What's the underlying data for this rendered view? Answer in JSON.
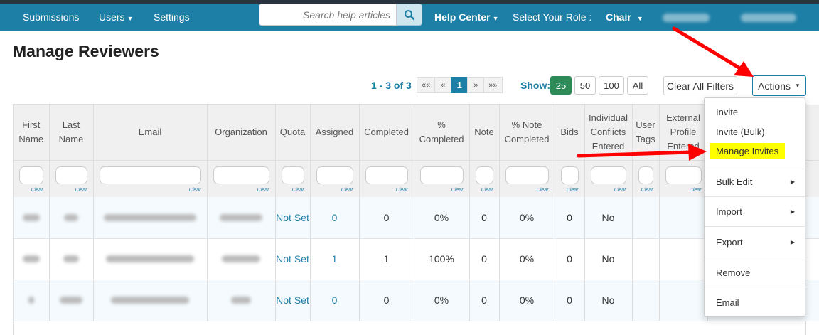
{
  "nav": {
    "submissions": "Submissions",
    "users": "Users",
    "settings": "Settings",
    "search_placeholder": "Search help articles",
    "help_center": "Help Center",
    "select_role": "Select Your Role :",
    "role": "Chair"
  },
  "page": {
    "title": "Manage Reviewers"
  },
  "pager": {
    "range": "1 - 3 of",
    "total": "3",
    "first": "««",
    "prev": "«",
    "current": "1",
    "next": "»",
    "last": "»»",
    "show_label": "Show:",
    "sizes": [
      "25",
      "50",
      "100",
      "All"
    ],
    "clear_all": "Clear All Filters",
    "actions": "Actions"
  },
  "table": {
    "headers": [
      "First Name",
      "Last Name",
      "Email",
      "Organization",
      "Quota",
      "Assigned",
      "Completed",
      "% Completed",
      "Note",
      "% Note Completed",
      "Bids",
      "Individual Conflicts Entered",
      "User Tags",
      "External Profile Entered"
    ],
    "clear_label": "Clear",
    "rows": [
      {
        "quota": "Not Set",
        "assigned": "0",
        "completed": "0",
        "pct_completed": "0%",
        "note": "0",
        "pct_note": "0%",
        "bids": "0",
        "conflicts": "No"
      },
      {
        "quota": "Not Set",
        "assigned": "1",
        "completed": "1",
        "pct_completed": "100%",
        "note": "0",
        "pct_note": "0%",
        "bids": "0",
        "conflicts": "No"
      },
      {
        "quota": "Not Set",
        "assigned": "0",
        "completed": "0",
        "pct_completed": "0%",
        "note": "0",
        "pct_note": "0%",
        "bids": "0",
        "conflicts": "No"
      }
    ]
  },
  "menu": {
    "invite": "Invite",
    "invite_bulk": "Invite (Bulk)",
    "manage_invites": "Manage Invites",
    "bulk_edit": "Bulk Edit",
    "import": "Import",
    "export": "Export",
    "remove": "Remove",
    "email": "Email"
  },
  "colors": {
    "nav_bg": "#1e7fa6",
    "active_size": "#2e8b57",
    "highlight": "#ffff00",
    "arrow": "#ff0000"
  }
}
